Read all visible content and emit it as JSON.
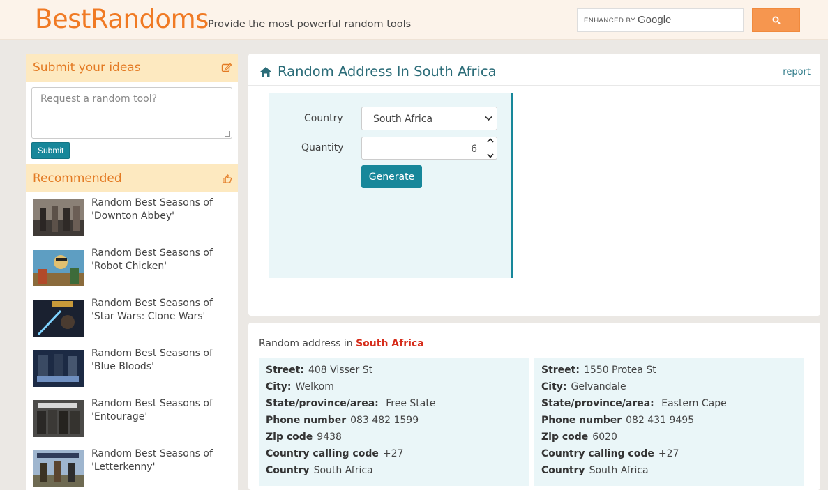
{
  "header": {
    "logo": "BestRandoms",
    "tagline": "Provide the most powerful random tools",
    "search_brand_prefix": "ENHANCED BY",
    "search_brand": "Google"
  },
  "sidebar": {
    "ideas_title": "Submit your ideas",
    "ideas_placeholder": "Request a random tool?",
    "submit_label": "Submit",
    "recommended_title": "Recommended",
    "items": [
      {
        "title": "Random Best Seasons of 'Downton Abbey'"
      },
      {
        "title": "Random Best Seasons of 'Robot Chicken'"
      },
      {
        "title": "Random Best Seasons of 'Star Wars: Clone Wars'"
      },
      {
        "title": "Random Best Seasons of 'Blue Bloods'"
      },
      {
        "title": "Random Best Seasons of 'Entourage'"
      },
      {
        "title": "Random Best Seasons of 'Letterkenny'"
      }
    ]
  },
  "main": {
    "title": "Random Address In South Africa",
    "report": "report",
    "country_label": "Country",
    "country_value": "South Africa",
    "quantity_label": "Quantity",
    "quantity_value": "6",
    "generate_label": "Generate"
  },
  "results": {
    "title_prefix": "Random address in",
    "title_country": "South Africa",
    "labels": {
      "street": "Street:",
      "city": "City:",
      "state": "State/province/area:",
      "phone": "Phone number",
      "zip": "Zip code",
      "calling": "Country calling code",
      "country": "Country"
    },
    "addresses": [
      {
        "street": "408 Visser St",
        "city": "Welkom",
        "state": "Free State",
        "phone": "083 482 1599",
        "zip": "9438",
        "calling": "+27",
        "country": "South Africa"
      },
      {
        "street": "1550 Protea St",
        "city": "Gelvandale",
        "state": "Eastern Cape",
        "phone": "082 431 9495",
        "zip": "6020",
        "calling": "+27",
        "country": "South Africa"
      }
    ]
  },
  "colors": {
    "brand_orange": "#f07a24",
    "teal": "#17879a",
    "panel_bg": "#eaf6f8",
    "accent_red": "#d62c1a"
  }
}
